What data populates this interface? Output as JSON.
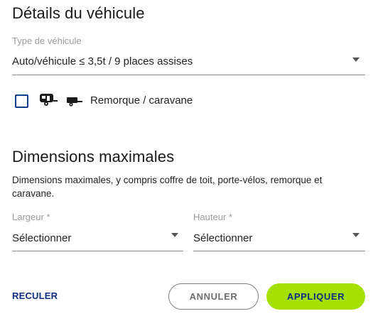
{
  "vehicle": {
    "title": "Détails du véhicule",
    "type_label": "Type de véhicule",
    "type_value": "Auto/véhicule ≤ 3,5t / 9 places assises",
    "trailer_checked": false,
    "trailer_label": "Remorque / caravane",
    "icons": [
      "caravan-icon",
      "trailer-icon"
    ]
  },
  "dimensions": {
    "title": "Dimensions maximales",
    "description": "Dimensions maximales, y compris coffre de toit, porte-vélos, remorque et caravane.",
    "width_label": "Largeur *",
    "width_value": "Sélectionner",
    "height_label": "Hauteur *",
    "height_value": "Sélectionner"
  },
  "actions": {
    "back": "RECULER",
    "cancel": "ANNULER",
    "apply": "APPLIQUER"
  },
  "colors": {
    "accent_green": "#a4e000",
    "primary_blue": "#0f2d82",
    "checkbox_border": "#123c8c"
  }
}
